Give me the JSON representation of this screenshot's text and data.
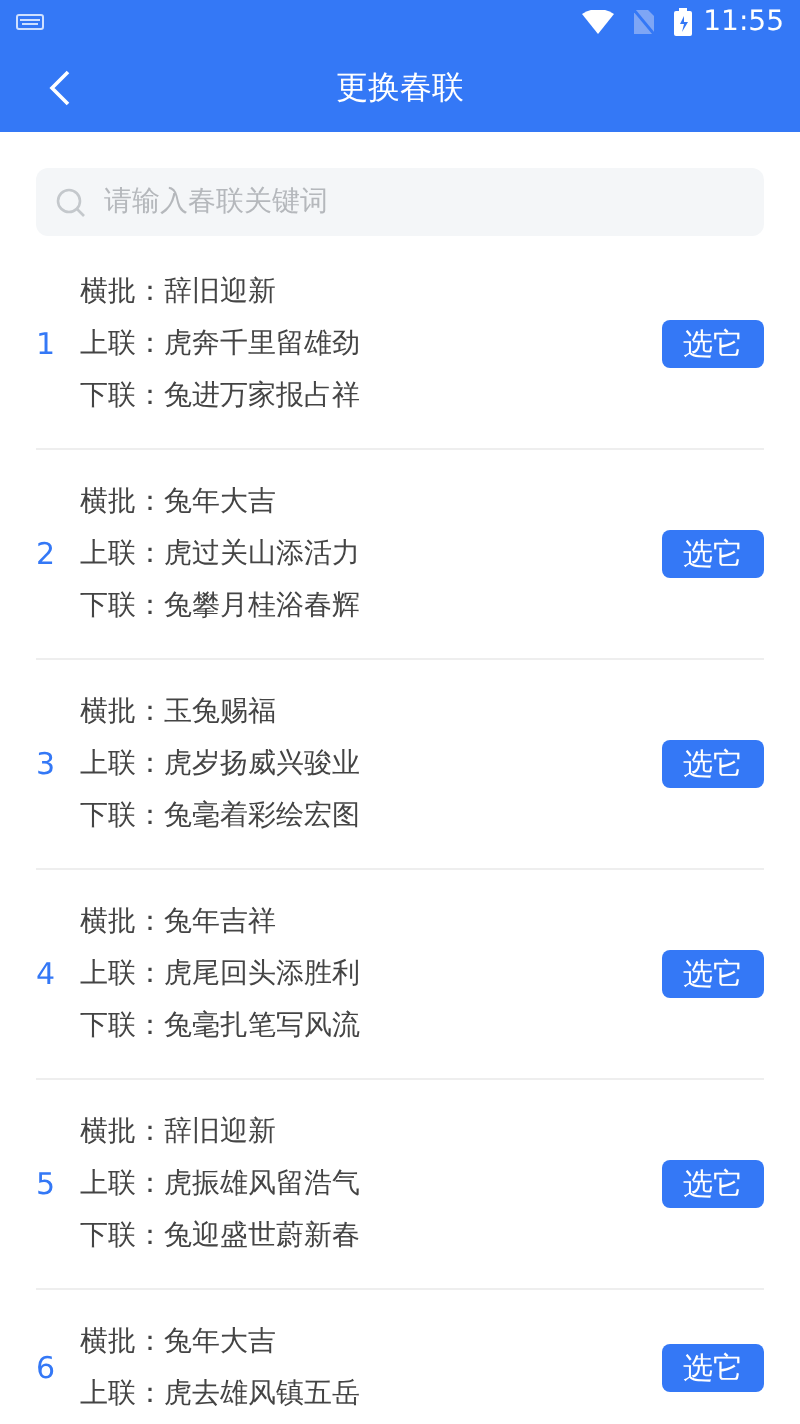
{
  "status_bar": {
    "time": "11:55"
  },
  "app_bar": {
    "title": "更换春联"
  },
  "search": {
    "placeholder": "请输入春联关键词"
  },
  "couplets": [
    {
      "number": "1",
      "lines": [
        "横批：辞旧迎新",
        "上联：虎奔千里留雄劲",
        "下联：兔进万家报占祥"
      ],
      "button": "选它"
    },
    {
      "number": "2",
      "lines": [
        "横批：兔年大吉",
        "上联：虎过关山添活力",
        "下联：兔攀月桂浴春辉"
      ],
      "button": "选它"
    },
    {
      "number": "3",
      "lines": [
        "横批：玉兔赐福",
        "上联：虎岁扬威兴骏业",
        "下联：兔毫着彩绘宏图"
      ],
      "button": "选它"
    },
    {
      "number": "4",
      "lines": [
        "横批：兔年吉祥",
        "上联：虎尾回头添胜利",
        "下联：兔毫扎笔写风流"
      ],
      "button": "选它"
    },
    {
      "number": "5",
      "lines": [
        "横批：辞旧迎新",
        "上联：虎振雄风留浩气",
        "下联：兔迎盛世蔚新春"
      ],
      "button": "选它"
    },
    {
      "number": "6",
      "lines": [
        "横批：兔年大吉",
        "上联：虎去雄风镇五岳"
      ],
      "button": "选它"
    }
  ]
}
